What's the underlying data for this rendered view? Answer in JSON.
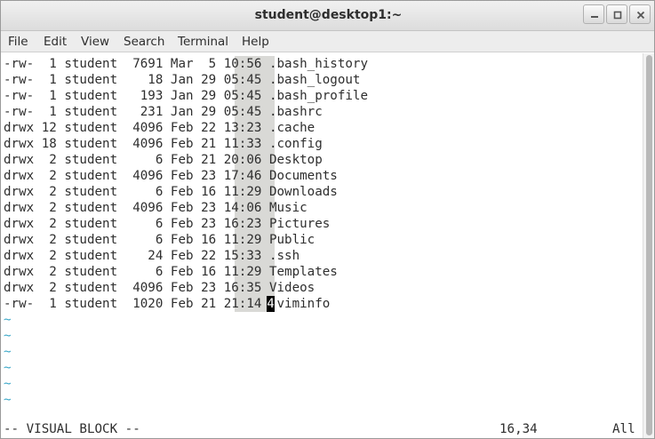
{
  "window": {
    "title": "student@desktop1:~"
  },
  "menubar": {
    "items": [
      "File",
      "Edit",
      "View",
      "Search",
      "Terminal",
      "Help"
    ]
  },
  "terminal": {
    "rows": [
      {
        "perm": "-rw-",
        "links": "1",
        "owner": "student",
        "size": "7691",
        "month": "Mar",
        "day": "5",
        "time": "10:56",
        "name": ".bash_history"
      },
      {
        "perm": "-rw-",
        "links": "1",
        "owner": "student",
        "size": "18",
        "month": "Jan",
        "day": "29",
        "time": "05:45",
        "name": ".bash_logout"
      },
      {
        "perm": "-rw-",
        "links": "1",
        "owner": "student",
        "size": "193",
        "month": "Jan",
        "day": "29",
        "time": "05:45",
        "name": ".bash_profile"
      },
      {
        "perm": "-rw-",
        "links": "1",
        "owner": "student",
        "size": "231",
        "month": "Jan",
        "day": "29",
        "time": "05:45",
        "name": ".bashrc"
      },
      {
        "perm": "drwx",
        "links": "12",
        "owner": "student",
        "size": "4096",
        "month": "Feb",
        "day": "22",
        "time": "13:23",
        "name": ".cache"
      },
      {
        "perm": "drwx",
        "links": "18",
        "owner": "student",
        "size": "4096",
        "month": "Feb",
        "day": "21",
        "time": "11:33",
        "name": ".config"
      },
      {
        "perm": "drwx",
        "links": "2",
        "owner": "student",
        "size": "6",
        "month": "Feb",
        "day": "21",
        "time": "20:06",
        "name": "Desktop"
      },
      {
        "perm": "drwx",
        "links": "2",
        "owner": "student",
        "size": "4096",
        "month": "Feb",
        "day": "23",
        "time": "17:46",
        "name": "Documents"
      },
      {
        "perm": "drwx",
        "links": "2",
        "owner": "student",
        "size": "6",
        "month": "Feb",
        "day": "16",
        "time": "11:29",
        "name": "Downloads"
      },
      {
        "perm": "drwx",
        "links": "2",
        "owner": "student",
        "size": "4096",
        "month": "Feb",
        "day": "23",
        "time": "14:06",
        "name": "Music"
      },
      {
        "perm": "drwx",
        "links": "2",
        "owner": "student",
        "size": "6",
        "month": "Feb",
        "day": "23",
        "time": "16:23",
        "name": "Pictures"
      },
      {
        "perm": "drwx",
        "links": "2",
        "owner": "student",
        "size": "6",
        "month": "Feb",
        "day": "16",
        "time": "11:29",
        "name": "Public"
      },
      {
        "perm": "drwx",
        "links": "2",
        "owner": "student",
        "size": "24",
        "month": "Feb",
        "day": "22",
        "time": "15:33",
        "name": ".ssh"
      },
      {
        "perm": "drwx",
        "links": "2",
        "owner": "student",
        "size": "6",
        "month": "Feb",
        "day": "16",
        "time": "11:29",
        "name": "Templates"
      },
      {
        "perm": "drwx",
        "links": "2",
        "owner": "student",
        "size": "4096",
        "month": "Feb",
        "day": "23",
        "time": "16:35",
        "name": "Videos"
      },
      {
        "perm": "-rw-",
        "links": "1",
        "owner": "student",
        "size": "1020",
        "month": "Feb",
        "day": "21",
        "time": "21:14",
        "name": ".viminfo"
      }
    ],
    "cursor_char": "4",
    "tilde": "~",
    "tilde_count": 6,
    "status_mode": "-- VISUAL BLOCK --",
    "cursor_position": "16,34",
    "scroll_indicator": "All"
  },
  "colors": {
    "selection": "#d9d9d6",
    "tilde": "#3aa7c8",
    "cursor": "#000000"
  }
}
